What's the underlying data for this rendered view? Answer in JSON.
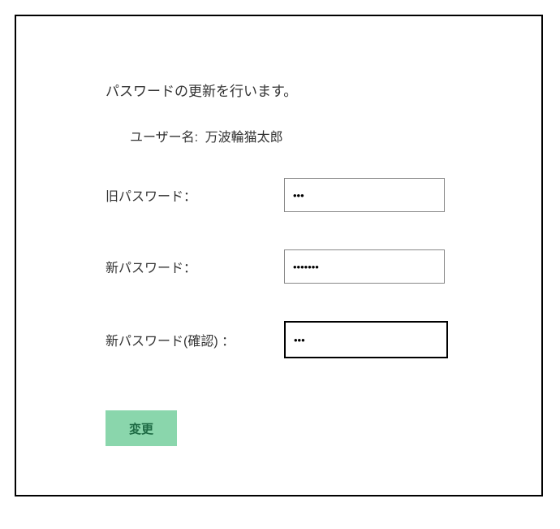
{
  "heading": "パスワードの更新を行います。",
  "username": {
    "label": "ユーザー名:",
    "value": "万波輪猫太郎"
  },
  "fields": {
    "old_password": {
      "label": "旧パスワード：",
      "value": "•••"
    },
    "new_password": {
      "label": "新パスワード：",
      "value": "•••••••"
    },
    "confirm_password": {
      "label": "新パスワード(確認) ：",
      "value": "•••"
    }
  },
  "submit_label": "変更"
}
